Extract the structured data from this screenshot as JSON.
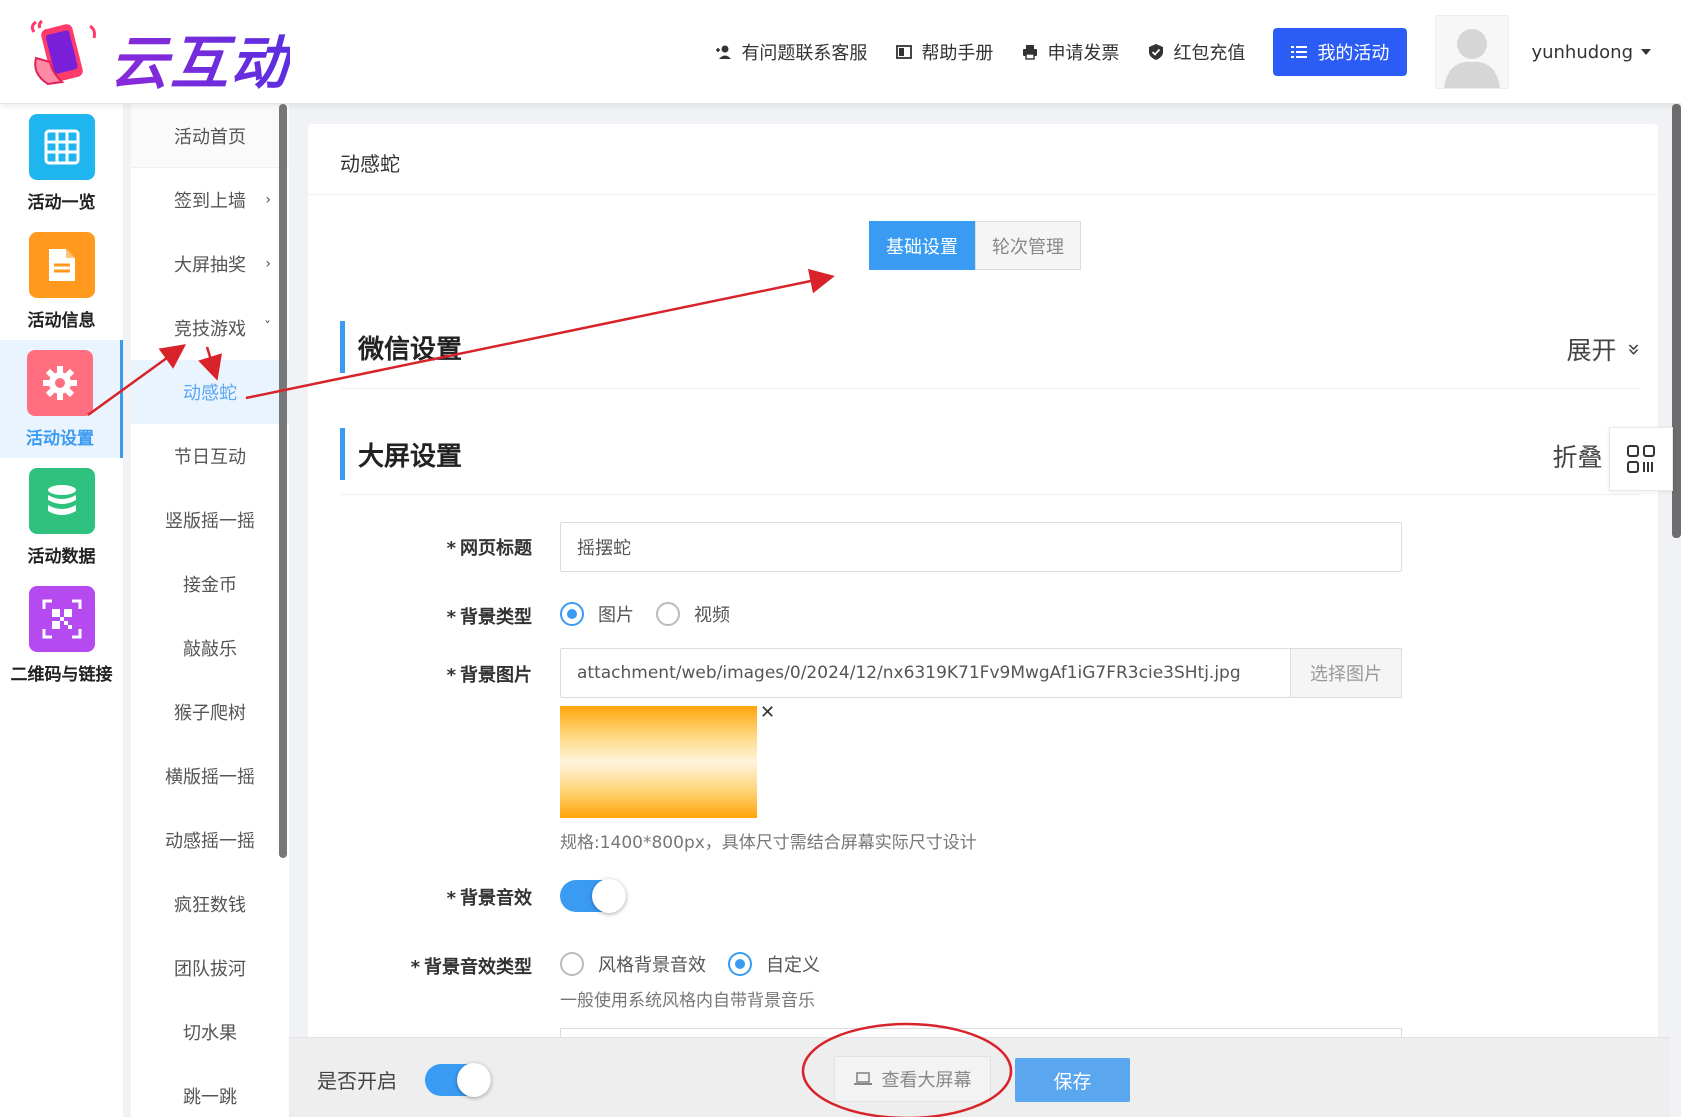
{
  "brand": {
    "name": "云互动"
  },
  "topnav": {
    "support": "有问题联系客服",
    "manual": "帮助手册",
    "invoice": "申请发票",
    "recharge": "红包充值",
    "my_activity": "我的活动",
    "username": "yunhudong"
  },
  "iconbar": {
    "items": [
      {
        "label": "活动一览",
        "color": "#1fb6f0",
        "icon": "grid-icon"
      },
      {
        "label": "活动信息",
        "color": "#ff9a1f",
        "icon": "document-icon"
      },
      {
        "label": "活动设置",
        "color": "#ff6f80",
        "icon": "gear-icon",
        "active": true
      },
      {
        "label": "活动数据",
        "color": "#2ec27e",
        "icon": "database-icon"
      },
      {
        "label": "二维码与链接",
        "color": "#b44af0",
        "icon": "qrcode-icon"
      }
    ]
  },
  "submenu": {
    "items": [
      {
        "label": "活动首页"
      },
      {
        "label": "签到上墙",
        "chevron": "›"
      },
      {
        "label": "大屏抽奖",
        "chevron": "›"
      },
      {
        "label": "竞技游戏",
        "chevron": "ˇ"
      },
      {
        "label": "动感蛇",
        "active": true
      },
      {
        "label": "节日互动"
      },
      {
        "label": "竖版摇一摇"
      },
      {
        "label": "接金币"
      },
      {
        "label": "敲敲乐"
      },
      {
        "label": "猴子爬树"
      },
      {
        "label": "横版摇一摇"
      },
      {
        "label": "动感摇一摇"
      },
      {
        "label": "疯狂数钱"
      },
      {
        "label": "团队拔河"
      },
      {
        "label": "切水果"
      },
      {
        "label": "跳一跳"
      }
    ]
  },
  "main": {
    "breadcrumb": "动感蛇",
    "tabs": [
      {
        "label": "基础设置",
        "active": true
      },
      {
        "label": "轮次管理",
        "active": false
      }
    ],
    "sections": {
      "wechat": {
        "title": "微信设置",
        "toggle": "展开",
        "toggle_icon": "»"
      },
      "screen": {
        "title": "大屏设置",
        "toggle": "折叠",
        "toggle_icon": "«"
      }
    },
    "form": {
      "page_title": {
        "label": "网页标题",
        "value": "摇摆蛇"
      },
      "bg_type": {
        "label": "背景类型",
        "options": [
          "图片",
          "视频"
        ],
        "selected": "图片"
      },
      "bg_image": {
        "label": "背景图片",
        "value": "attachment/web/images/0/2024/12/nx6319K71Fv9MwgAf1iG7FR3cie3SHtj.jpg",
        "button": "选择图片",
        "hint": "规格:1400*800px，具体尺寸需结合屏幕实际尺寸设计"
      },
      "bg_sound": {
        "label": "背景音效",
        "enabled": true
      },
      "bg_sound_type": {
        "label": "背景音效类型",
        "options": [
          "风格背景音效",
          "自定义"
        ],
        "selected": "自定义",
        "hint": "一般使用系统风格内自带背景音乐"
      }
    }
  },
  "bottombar": {
    "enable_label": "是否开启",
    "enabled": true,
    "view_screen": "查看大屏幕",
    "save": "保存"
  },
  "annotation_color": "#d8232a"
}
